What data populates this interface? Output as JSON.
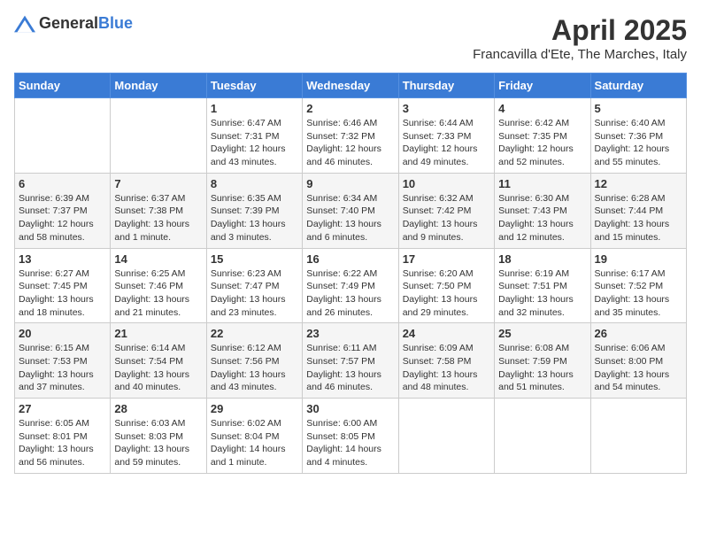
{
  "header": {
    "logo_general": "General",
    "logo_blue": "Blue",
    "month_title": "April 2025",
    "location": "Francavilla d'Ete, The Marches, Italy"
  },
  "days_of_week": [
    "Sunday",
    "Monday",
    "Tuesday",
    "Wednesday",
    "Thursday",
    "Friday",
    "Saturday"
  ],
  "weeks": [
    [
      {
        "day": "",
        "sunrise": "",
        "sunset": "",
        "daylight": ""
      },
      {
        "day": "",
        "sunrise": "",
        "sunset": "",
        "daylight": ""
      },
      {
        "day": "1",
        "sunrise": "Sunrise: 6:47 AM",
        "sunset": "Sunset: 7:31 PM",
        "daylight": "Daylight: 12 hours and 43 minutes."
      },
      {
        "day": "2",
        "sunrise": "Sunrise: 6:46 AM",
        "sunset": "Sunset: 7:32 PM",
        "daylight": "Daylight: 12 hours and 46 minutes."
      },
      {
        "day": "3",
        "sunrise": "Sunrise: 6:44 AM",
        "sunset": "Sunset: 7:33 PM",
        "daylight": "Daylight: 12 hours and 49 minutes."
      },
      {
        "day": "4",
        "sunrise": "Sunrise: 6:42 AM",
        "sunset": "Sunset: 7:35 PM",
        "daylight": "Daylight: 12 hours and 52 minutes."
      },
      {
        "day": "5",
        "sunrise": "Sunrise: 6:40 AM",
        "sunset": "Sunset: 7:36 PM",
        "daylight": "Daylight: 12 hours and 55 minutes."
      }
    ],
    [
      {
        "day": "6",
        "sunrise": "Sunrise: 6:39 AM",
        "sunset": "Sunset: 7:37 PM",
        "daylight": "Daylight: 12 hours and 58 minutes."
      },
      {
        "day": "7",
        "sunrise": "Sunrise: 6:37 AM",
        "sunset": "Sunset: 7:38 PM",
        "daylight": "Daylight: 13 hours and 1 minute."
      },
      {
        "day": "8",
        "sunrise": "Sunrise: 6:35 AM",
        "sunset": "Sunset: 7:39 PM",
        "daylight": "Daylight: 13 hours and 3 minutes."
      },
      {
        "day": "9",
        "sunrise": "Sunrise: 6:34 AM",
        "sunset": "Sunset: 7:40 PM",
        "daylight": "Daylight: 13 hours and 6 minutes."
      },
      {
        "day": "10",
        "sunrise": "Sunrise: 6:32 AM",
        "sunset": "Sunset: 7:42 PM",
        "daylight": "Daylight: 13 hours and 9 minutes."
      },
      {
        "day": "11",
        "sunrise": "Sunrise: 6:30 AM",
        "sunset": "Sunset: 7:43 PM",
        "daylight": "Daylight: 13 hours and 12 minutes."
      },
      {
        "day": "12",
        "sunrise": "Sunrise: 6:28 AM",
        "sunset": "Sunset: 7:44 PM",
        "daylight": "Daylight: 13 hours and 15 minutes."
      }
    ],
    [
      {
        "day": "13",
        "sunrise": "Sunrise: 6:27 AM",
        "sunset": "Sunset: 7:45 PM",
        "daylight": "Daylight: 13 hours and 18 minutes."
      },
      {
        "day": "14",
        "sunrise": "Sunrise: 6:25 AM",
        "sunset": "Sunset: 7:46 PM",
        "daylight": "Daylight: 13 hours and 21 minutes."
      },
      {
        "day": "15",
        "sunrise": "Sunrise: 6:23 AM",
        "sunset": "Sunset: 7:47 PM",
        "daylight": "Daylight: 13 hours and 23 minutes."
      },
      {
        "day": "16",
        "sunrise": "Sunrise: 6:22 AM",
        "sunset": "Sunset: 7:49 PM",
        "daylight": "Daylight: 13 hours and 26 minutes."
      },
      {
        "day": "17",
        "sunrise": "Sunrise: 6:20 AM",
        "sunset": "Sunset: 7:50 PM",
        "daylight": "Daylight: 13 hours and 29 minutes."
      },
      {
        "day": "18",
        "sunrise": "Sunrise: 6:19 AM",
        "sunset": "Sunset: 7:51 PM",
        "daylight": "Daylight: 13 hours and 32 minutes."
      },
      {
        "day": "19",
        "sunrise": "Sunrise: 6:17 AM",
        "sunset": "Sunset: 7:52 PM",
        "daylight": "Daylight: 13 hours and 35 minutes."
      }
    ],
    [
      {
        "day": "20",
        "sunrise": "Sunrise: 6:15 AM",
        "sunset": "Sunset: 7:53 PM",
        "daylight": "Daylight: 13 hours and 37 minutes."
      },
      {
        "day": "21",
        "sunrise": "Sunrise: 6:14 AM",
        "sunset": "Sunset: 7:54 PM",
        "daylight": "Daylight: 13 hours and 40 minutes."
      },
      {
        "day": "22",
        "sunrise": "Sunrise: 6:12 AM",
        "sunset": "Sunset: 7:56 PM",
        "daylight": "Daylight: 13 hours and 43 minutes."
      },
      {
        "day": "23",
        "sunrise": "Sunrise: 6:11 AM",
        "sunset": "Sunset: 7:57 PM",
        "daylight": "Daylight: 13 hours and 46 minutes."
      },
      {
        "day": "24",
        "sunrise": "Sunrise: 6:09 AM",
        "sunset": "Sunset: 7:58 PM",
        "daylight": "Daylight: 13 hours and 48 minutes."
      },
      {
        "day": "25",
        "sunrise": "Sunrise: 6:08 AM",
        "sunset": "Sunset: 7:59 PM",
        "daylight": "Daylight: 13 hours and 51 minutes."
      },
      {
        "day": "26",
        "sunrise": "Sunrise: 6:06 AM",
        "sunset": "Sunset: 8:00 PM",
        "daylight": "Daylight: 13 hours and 54 minutes."
      }
    ],
    [
      {
        "day": "27",
        "sunrise": "Sunrise: 6:05 AM",
        "sunset": "Sunset: 8:01 PM",
        "daylight": "Daylight: 13 hours and 56 minutes."
      },
      {
        "day": "28",
        "sunrise": "Sunrise: 6:03 AM",
        "sunset": "Sunset: 8:03 PM",
        "daylight": "Daylight: 13 hours and 59 minutes."
      },
      {
        "day": "29",
        "sunrise": "Sunrise: 6:02 AM",
        "sunset": "Sunset: 8:04 PM",
        "daylight": "Daylight: 14 hours and 1 minute."
      },
      {
        "day": "30",
        "sunrise": "Sunrise: 6:00 AM",
        "sunset": "Sunset: 8:05 PM",
        "daylight": "Daylight: 14 hours and 4 minutes."
      },
      {
        "day": "",
        "sunrise": "",
        "sunset": "",
        "daylight": ""
      },
      {
        "day": "",
        "sunrise": "",
        "sunset": "",
        "daylight": ""
      },
      {
        "day": "",
        "sunrise": "",
        "sunset": "",
        "daylight": ""
      }
    ]
  ]
}
